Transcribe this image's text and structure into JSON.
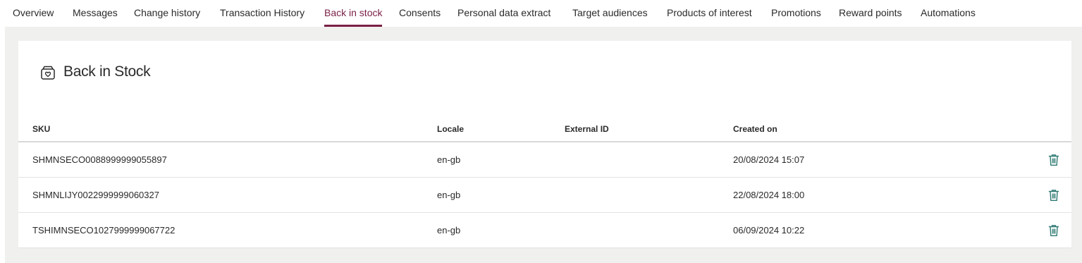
{
  "tabs": [
    {
      "label": "Overview",
      "active": false
    },
    {
      "label": "Messages",
      "active": false
    },
    {
      "label": "Change history",
      "active": false
    },
    {
      "label": "Transaction History",
      "active": false
    },
    {
      "label": "Back in stock",
      "active": true
    },
    {
      "label": "Consents",
      "active": false
    },
    {
      "label": "Personal data extract",
      "active": false
    },
    {
      "label": "Target audiences",
      "active": false
    },
    {
      "label": "Products of interest",
      "active": false
    },
    {
      "label": "Promotions",
      "active": false
    },
    {
      "label": "Reward points",
      "active": false
    },
    {
      "label": "Automations",
      "active": false
    }
  ],
  "card": {
    "title": "Back in Stock",
    "icon": "heart-box-icon"
  },
  "table": {
    "headers": {
      "sku": "SKU",
      "locale": "Locale",
      "external_id": "External ID",
      "created_on": "Created on"
    },
    "rows": [
      {
        "sku": "SHMNSECO0088999999055897",
        "locale": "en-gb",
        "external_id": "",
        "created_on": "20/08/2024 15:07"
      },
      {
        "sku": "SHMNLIJY0022999999060327",
        "locale": "en-gb",
        "external_id": "",
        "created_on": "22/08/2024 18:00"
      },
      {
        "sku": "TSHIMNSECO1027999999067722",
        "locale": "en-gb",
        "external_id": "",
        "created_on": "06/09/2024 10:22"
      }
    ],
    "row_action_icon": "trash-icon"
  },
  "colors": {
    "accent": "#7a1f45",
    "icon_teal": "#2f7a73",
    "background": "#f0f0ee"
  }
}
